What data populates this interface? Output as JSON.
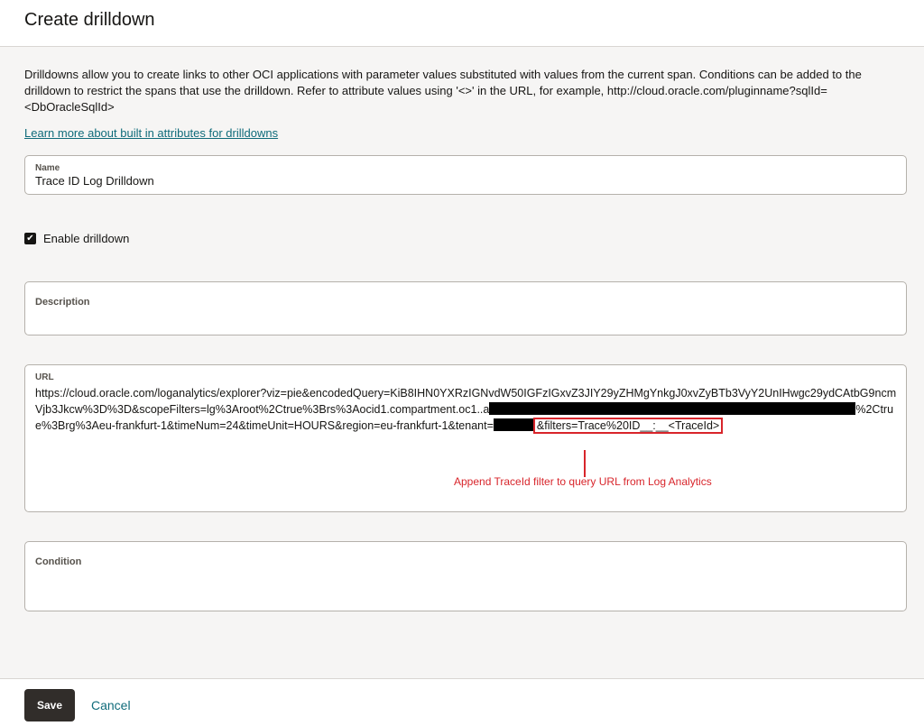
{
  "header": {
    "title": "Create drilldown"
  },
  "intro": {
    "text": "Drilldowns allow you to create links to other OCI applications with parameter values substituted with values from the current span. Conditions can be added to the drilldown to restrict the spans that use the drilldown. Refer to attribute values using '<>' in the URL, for example, http://cloud.oracle.com/pluginname?sqlId=<DbOracleSqlId>",
    "link": "Learn more about built in attributes for drilldowns"
  },
  "name_field": {
    "label": "Name",
    "value": "Trace ID Log Drilldown"
  },
  "enable": {
    "label": "Enable drilldown",
    "checked": true
  },
  "description_field": {
    "label": "Description",
    "value": ""
  },
  "url_field": {
    "label": "URL",
    "part1": "https://cloud.oracle.com/loganalytics/explorer?viz=pie&encodedQuery=KiB8IHN0YXRzIGNvdW50IGFzIGxvZ3JIY29yZHMgYnkgJ0xvZyBTb3VyY2UnIHwgc29ydCAtbG9ncmVjb3Jkcw%3D%3D&scopeFilters=lg%3Aroot%2Ctrue%3Brs%3Aocid1.compartment.oc1..a",
    "part2": "%2Ctrue%3Brg%3Aeu-frankfurt-1&timeNum=24&timeUnit=HOURS&region=eu-frankfurt-1&tenant=",
    "highlighted": "&filters=Trace%20ID__:__<TraceId>"
  },
  "annotation": {
    "text": "Append TraceId filter to query URL from Log Analytics",
    "color": "#d8252b"
  },
  "condition_field": {
    "label": "Condition",
    "value": ""
  },
  "footer": {
    "save_label": "Save",
    "cancel_label": "Cancel"
  },
  "colors": {
    "primary_button": "#312d2a",
    "link": "#0f6b7a",
    "background": "#f6f5f4"
  }
}
